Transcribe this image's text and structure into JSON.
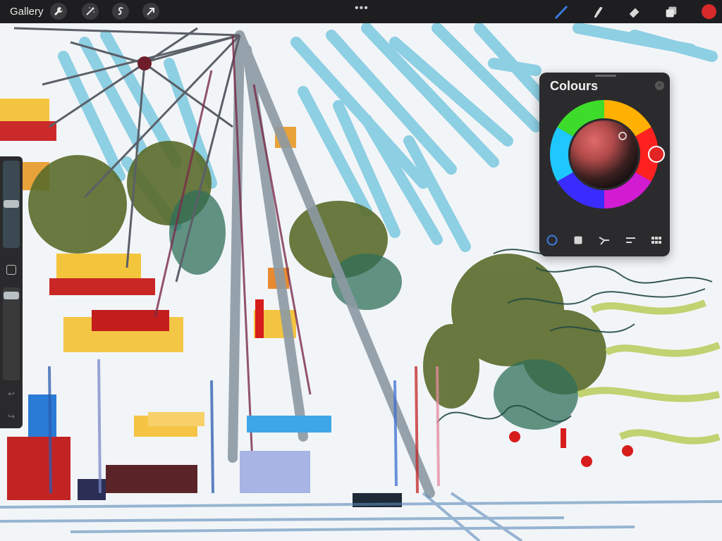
{
  "topbar": {
    "gallery_label": "Gallery",
    "actions": [
      {
        "name": "actions-button",
        "icon": "wrench-icon"
      },
      {
        "name": "adjustments-button",
        "icon": "magic-wand-icon"
      },
      {
        "name": "selection-button",
        "icon": "selection-s-icon"
      },
      {
        "name": "transform-button",
        "icon": "arrow-cursor-icon"
      }
    ],
    "more_label": "•••",
    "tools": [
      {
        "name": "brush-tool",
        "icon": "brush-icon",
        "active": true
      },
      {
        "name": "smudge-tool",
        "icon": "smudge-finger-icon"
      },
      {
        "name": "eraser-tool",
        "icon": "eraser-icon"
      },
      {
        "name": "layers-tool",
        "icon": "layers-icon"
      }
    ],
    "current_colour": "#d82a2a",
    "active_tool_colour": "#3b7de0"
  },
  "sidebar": {
    "brush_size_level": 0.22,
    "opacity_level": 0.08,
    "undo_label": "↩",
    "redo_label": "↪"
  },
  "colours_panel": {
    "title": "Colours",
    "close_label": "×",
    "hue_selected": "#e22424",
    "modes": [
      {
        "name": "disc-mode-tab",
        "icon": "circle-icon",
        "active": true
      },
      {
        "name": "classic-mode-tab",
        "icon": "square-icon"
      },
      {
        "name": "harmony-mode-tab",
        "icon": "harmony-icon"
      },
      {
        "name": "value-mode-tab",
        "icon": "sliders-icon"
      },
      {
        "name": "palettes-mode-tab",
        "icon": "grid-icon"
      }
    ]
  }
}
